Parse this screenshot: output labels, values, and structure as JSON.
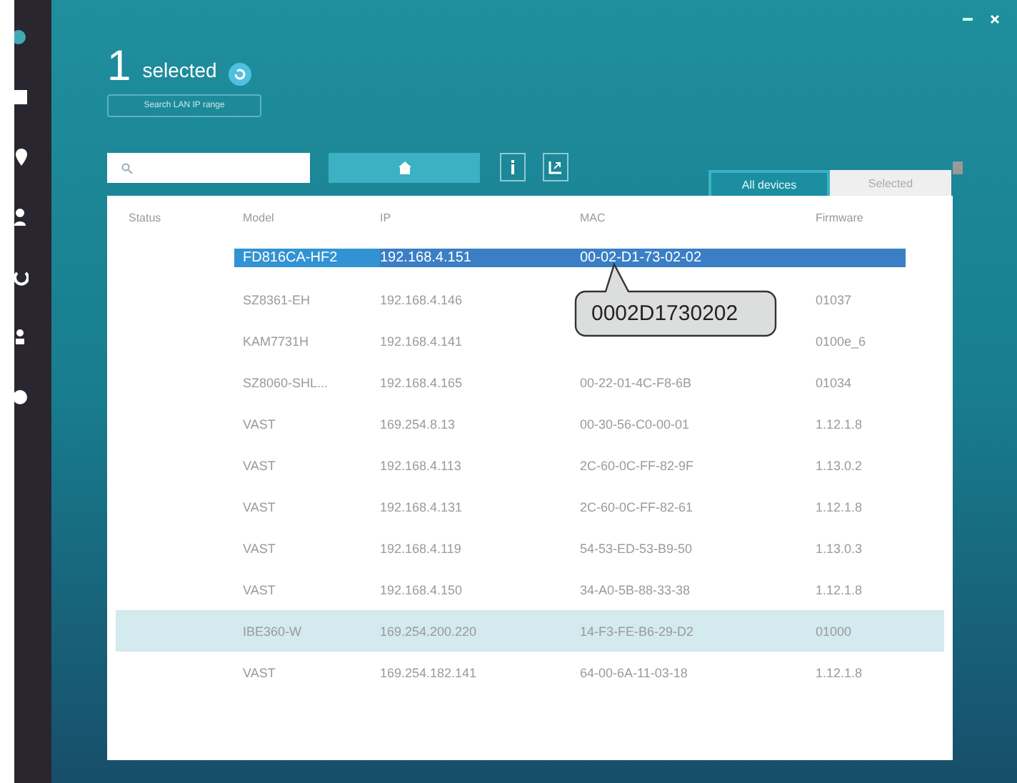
{
  "header": {
    "count": "1",
    "label": "selected",
    "search_button": "Search LAN IP range"
  },
  "tabs": [
    {
      "label": "All devices",
      "selected": true
    },
    {
      "label": "Selected",
      "selected": false
    }
  ],
  "table": {
    "columns": [
      "Status",
      "Model",
      "IP",
      "MAC",
      "Firmware"
    ],
    "rows": [
      {
        "model": "FD816CA-HF2",
        "ip": "192.168.4.151",
        "mac": "00-02-D1-73-02-02",
        "selected": true,
        "highlighted": false
      },
      {
        "model": "SZ8361-EH",
        "ip": "192.168.4.146",
        "firmware": "01037",
        "selected": false,
        "highlighted": false
      },
      {
        "model": "KAM7731H",
        "ip": "192.168.4.141",
        "firmware": "0100e_6",
        "selected": false,
        "highlighted": false
      },
      {
        "model": "SZ8060-SHL...",
        "ip": "192.168.4.165",
        "mac": "00-22-01-4C-F8-6B",
        "firmware": "01034",
        "selected": false,
        "highlighted": false
      },
      {
        "model": "VAST",
        "ip": "169.254.8.13",
        "mac": "00-30-56-C0-00-01",
        "firmware": "1.12.1.8",
        "selected": false,
        "highlighted": false
      },
      {
        "model": "VAST",
        "ip": "192.168.4.113",
        "mac": "2C-60-0C-FF-82-9F",
        "firmware": "1.13.0.2",
        "selected": false,
        "highlighted": false
      },
      {
        "model": "VAST",
        "ip": "192.168.4.131",
        "mac": "2C-60-0C-FF-82-61",
        "firmware": "1.12.1.8",
        "selected": false,
        "highlighted": false
      },
      {
        "model": "VAST",
        "ip": "192.168.4.119",
        "mac": "54-53-ED-53-B9-50",
        "firmware": "1.13.0.3",
        "selected": false,
        "highlighted": false
      },
      {
        "model": "VAST",
        "ip": "192.168.4.150",
        "mac": "34-A0-5B-88-33-38",
        "firmware": "1.12.1.8",
        "selected": false,
        "highlighted": false
      },
      {
        "model": "IBE360-W",
        "ip": "169.254.200.220",
        "mac": "14-F3-FE-B6-29-D2",
        "firmware": "01000",
        "selected": false,
        "highlighted": true
      },
      {
        "model": "VAST",
        "ip": "169.254.182.141",
        "mac": "64-00-6A-11-03-18",
        "firmware": "1.12.1.8",
        "selected": false,
        "highlighted": false
      }
    ]
  },
  "callout": {
    "text": "0002D1730202"
  }
}
